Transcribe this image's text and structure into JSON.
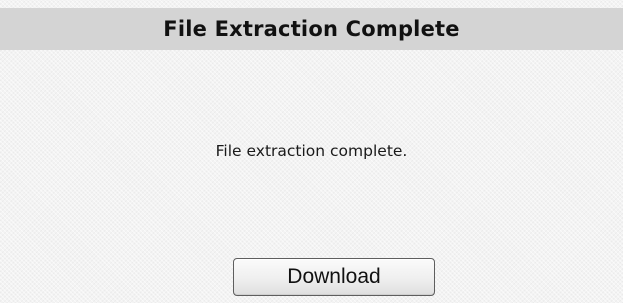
{
  "dialog": {
    "title": "File Extraction Complete",
    "message": "File extraction complete.",
    "download_label": "Download"
  }
}
